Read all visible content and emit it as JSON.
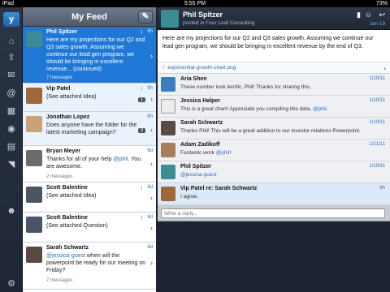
{
  "status_bar": {
    "carrier": "iPad",
    "time": "5:55 PM",
    "battery": "73%"
  },
  "rail": {
    "logo": "y",
    "icons": [
      "home-icon",
      "upload-icon",
      "inbox-icon",
      "at-icon",
      "groups-icon",
      "globe-icon",
      "directory-icon",
      "rss-icon",
      "people-icon"
    ]
  },
  "feed": {
    "title": "My Feed",
    "items": [
      {
        "name": "Phil Spitzer",
        "time": "6h",
        "text": "Here are my projections for our Q2 and Q3 sales growth. Assuming we continue our lead gen program, we should be bringing in excellent revenue... (continued)",
        "meta": "7 messages",
        "selected": true,
        "clip": true
      },
      {
        "name": "Vip Patel",
        "time": "6h",
        "text": "(See attached Idea)",
        "meta": "",
        "count": "1",
        "clip": true
      },
      {
        "name": "Jonathan Lopez",
        "time": "6h",
        "text": "Does anyone have the folder for the latest marketing campaign?",
        "meta": "",
        "count": "3"
      },
      {
        "name": "Bryan Meyer",
        "time": "6d",
        "text_pre": "Thanks for all of your help ",
        "mention": "@phil",
        "text_post": ". You are awesome.",
        "meta": "2 messages"
      },
      {
        "name": "Scott Balentine",
        "time": "6d",
        "text": "(See attached Idea)",
        "meta": "",
        "clip": true
      },
      {
        "name": "Scott Balentine",
        "time": "6d",
        "text": "(See attached Question)",
        "meta": "",
        "clip": true
      },
      {
        "name": "Sarah Schwartz",
        "time": "6d",
        "mention": "@jessica-guest",
        "text_post": " when will the powerpoint be ready for our meeting on Friday?",
        "meta": "7 messages"
      }
    ]
  },
  "thread": {
    "author": "Phil Spitzer",
    "posted_in": "posted in Four Leaf Consulting",
    "date": "Jan 19",
    "body": "Here are my projections for our Q2 and Q3 sales growth. Assuming we continue our lead gen program, we should be bringing in excellent revenue by the end of Q3.",
    "attachment": "exponential-growth-chart.png",
    "replies": [
      {
        "name": "Aria Shen",
        "time": "1/19/11",
        "text": "These number look terrific, Phil! Thanks for sharing this."
      },
      {
        "name": "Jessica Halper",
        "time": "1/19/11",
        "text_pre": "This is a great chart! Appreciate you compiling this data, ",
        "mention": "@phil",
        "text_post": "."
      },
      {
        "name": "Sarah Schwartz",
        "time": "1/19/11",
        "text": "Thanks Phil! This will be a great addition to our investor relations Powerpoint."
      },
      {
        "name": "Adam Zadikoff",
        "time": "1/21/11",
        "text_pre": "Fantastic work ",
        "mention": "@phil",
        "text_post": "!"
      },
      {
        "name": "Phil Spitzer",
        "time": "1/19/11",
        "mention": "@jessica-guest"
      },
      {
        "name": "Vip Patel re: Sarah Schwartz",
        "time": "6h",
        "text": "I agree.",
        "highlight": true
      }
    ],
    "reply_placeholder": "Write a reply..."
  }
}
